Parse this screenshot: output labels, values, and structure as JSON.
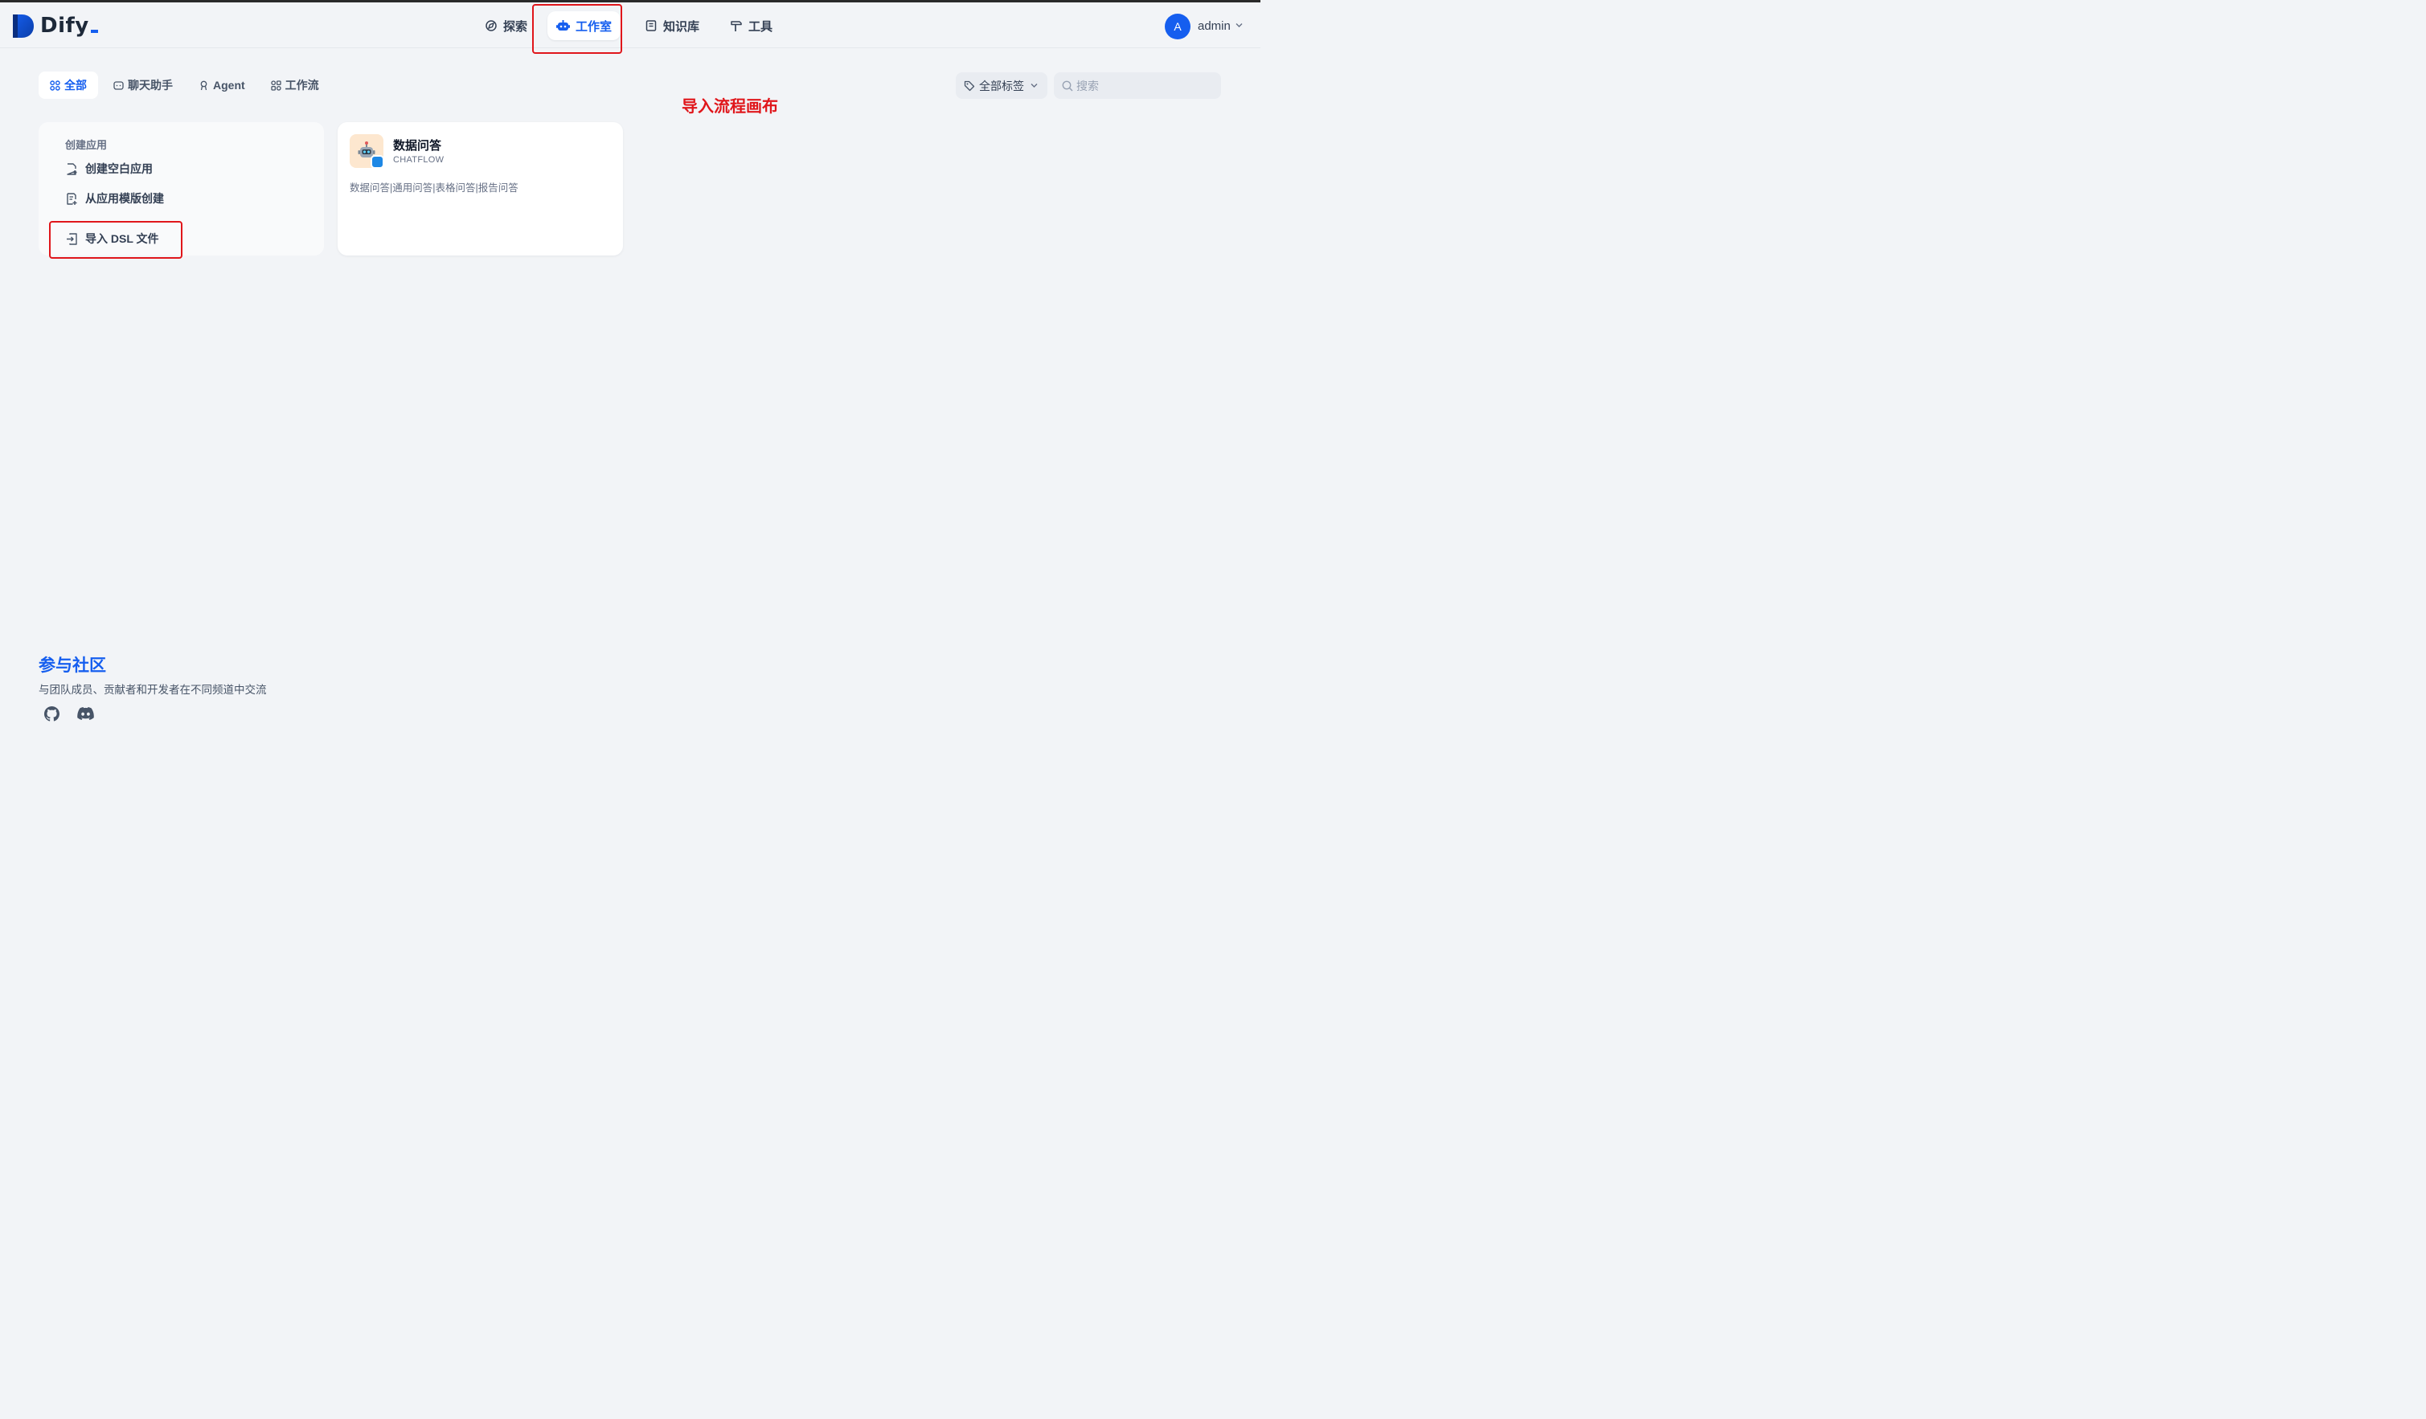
{
  "brand": {
    "name": "Dify",
    "accent": "#155eef"
  },
  "nav": [
    {
      "label": "探索",
      "icon": "compass-icon",
      "active": false
    },
    {
      "label": "工作室",
      "icon": "robot-icon",
      "active": true
    },
    {
      "label": "知识库",
      "icon": "book-icon",
      "active": false
    },
    {
      "label": "工具",
      "icon": "hammer-icon",
      "active": false
    }
  ],
  "user": {
    "initial": "A",
    "name": "admin"
  },
  "tabs": [
    {
      "label": "全部",
      "icon": "grid-icon",
      "active": true
    },
    {
      "label": "聊天助手",
      "icon": "chat-icon",
      "active": false
    },
    {
      "label": "Agent",
      "icon": "agent-icon",
      "active": false
    },
    {
      "label": "工作流",
      "icon": "workflow-icon",
      "active": false
    }
  ],
  "filters": {
    "tag_label": "全部标签",
    "search_placeholder": "搜索"
  },
  "annotation": "导入流程画布",
  "create": {
    "title": "创建应用",
    "blank": "创建空白应用",
    "template": "从应用模版创建",
    "import_dsl": "导入 DSL 文件"
  },
  "apps": [
    {
      "name": "数据问答",
      "type": "CHATFLOW",
      "description": "数据问答|通用问答|表格问答|报告问答",
      "icon": "robot-emoji-icon"
    }
  ],
  "community": {
    "title": "参与社区",
    "description": "与团队成员、贡献者和开发者在不同频道中交流",
    "links": [
      "github-icon",
      "discord-icon"
    ]
  },
  "colors": {
    "highlight_box": "#e0161b",
    "annotation_text": "#e0161b"
  }
}
